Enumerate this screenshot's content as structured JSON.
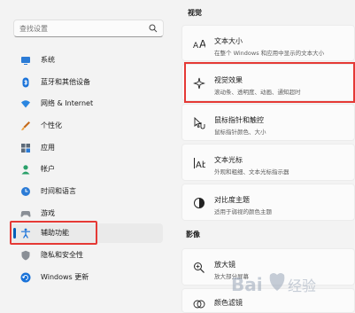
{
  "search": {
    "placeholder": "查找设置"
  },
  "sidebar": {
    "items": [
      {
        "label": "系统",
        "icon": "monitor-icon"
      },
      {
        "label": "蓝牙和其他设备",
        "icon": "bluetooth-icon"
      },
      {
        "label": "网络 & Internet",
        "icon": "wifi-icon"
      },
      {
        "label": "个性化",
        "icon": "brush-icon"
      },
      {
        "label": "应用",
        "icon": "apps-icon"
      },
      {
        "label": "帐户",
        "icon": "person-icon"
      },
      {
        "label": "时间和语言",
        "icon": "clock-globe-icon"
      },
      {
        "label": "游戏",
        "icon": "gamepad-icon"
      },
      {
        "label": "辅助功能",
        "icon": "accessibility-icon",
        "active": true
      },
      {
        "label": "隐私和安全性",
        "icon": "shield-icon"
      },
      {
        "label": "Windows 更新",
        "icon": "update-icon"
      }
    ]
  },
  "main": {
    "section_vision": "视觉",
    "section_hearing": "影像",
    "cards": [
      {
        "title": "文本大小",
        "subtitle": "在整个 Windows 和应用中显示的文本大小",
        "icon": "text-size-icon"
      },
      {
        "title": "视觉效果",
        "subtitle": "滚动条、透明度、动画、通知超时",
        "icon": "sparkle-icon"
      },
      {
        "title": "鼠标指针和触控",
        "subtitle": "鼠标指针颜色、大小",
        "icon": "pointer-touch-icon"
      },
      {
        "title": "文本光标",
        "subtitle": "外观和粗细、文本光标指示器",
        "icon": "text-cursor-icon"
      },
      {
        "title": "对比度主题",
        "subtitle": "适用于弱视的颜色主题",
        "icon": "contrast-icon"
      },
      {
        "title": "放大镜",
        "subtitle": "放大部分屏幕",
        "icon": "magnifier-icon"
      },
      {
        "title": "颜色滤镜",
        "subtitle": "",
        "icon": "color-filter-icon"
      }
    ]
  },
  "watermark": {
    "text": "Baidu经验"
  },
  "colors": {
    "accent": "#005fb8",
    "highlight": "#e53935"
  }
}
